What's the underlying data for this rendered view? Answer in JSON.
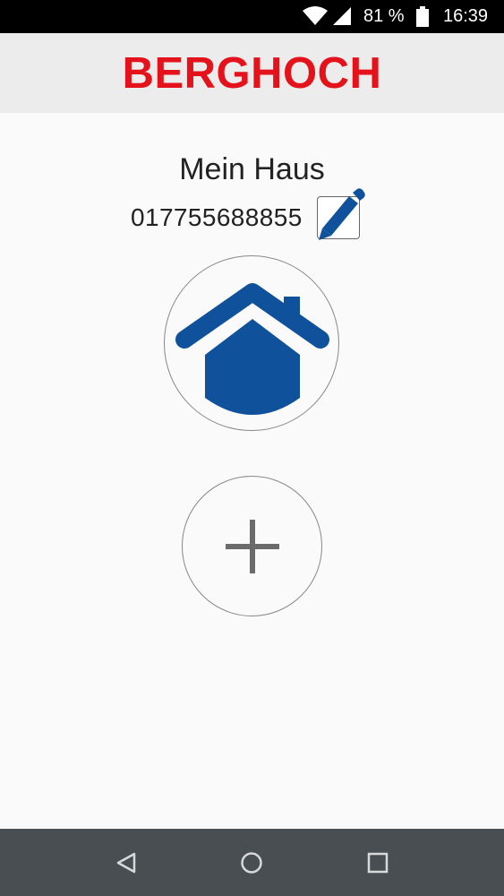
{
  "status_bar": {
    "battery_percent": "81 %",
    "time": "16:39",
    "icons": [
      "wifi-icon",
      "cell-signal-icon",
      "battery-icon"
    ]
  },
  "header": {
    "logo_text": "BERGHOCH",
    "brand_color": "#e3121b"
  },
  "home": {
    "name": "Mein Haus",
    "phone_number": "017755688855",
    "icon": "house-icon",
    "accent_color": "#0f529b"
  },
  "actions": {
    "edit_icon": "pencil-icon",
    "add_icon": "plus-icon"
  },
  "nav_bar": {
    "icons": [
      "back-icon",
      "home-icon",
      "recents-icon"
    ]
  }
}
